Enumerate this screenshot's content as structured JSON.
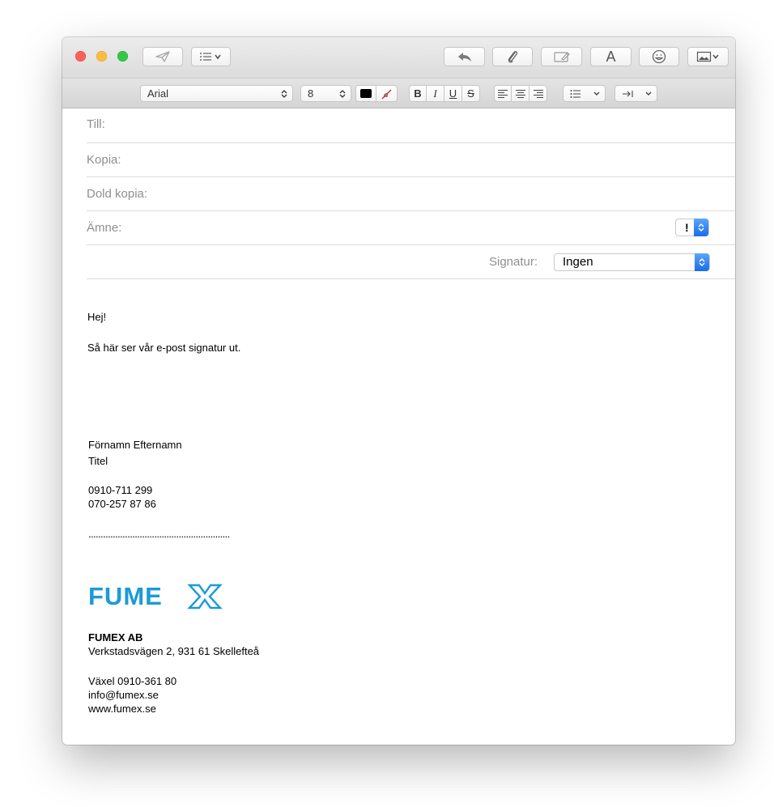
{
  "toolbar": {
    "font_name": "Arial",
    "font_size": "8",
    "font_button_label": "A"
  },
  "format": {
    "bold": "B",
    "italic": "I",
    "underline": "U",
    "strike": "S"
  },
  "headers": {
    "to_label": "Till:",
    "cc_label": "Kopia:",
    "bcc_label": "Dold kopia:",
    "subject_label": "Ämne:",
    "priority_label": "!",
    "signature_label": "Signatur:",
    "signature_value": "Ingen"
  },
  "message": {
    "greeting": "Hej!",
    "intro": "Så här ser vår e-post signatur ut.",
    "name": "Förnamn Efternamn",
    "title": "Titel",
    "phone1": "0910-711 299",
    "phone2": "070-257 87 86",
    "separator": "..........................................................",
    "logo_text": "FUMEX",
    "company": "FUMEX AB",
    "address": "Verkstadsvägen 2, 931 61 Skellefteå",
    "switchboard": "Växel 0910-361 80",
    "email": "info@fumex.se",
    "web": "www.fumex.se"
  },
  "colors": {
    "logo_blue": "#1b9bd7",
    "close": "#fc605b",
    "minimize": "#fdbc40",
    "zoom": "#34c84a",
    "text_color_swatch": "#000000"
  }
}
